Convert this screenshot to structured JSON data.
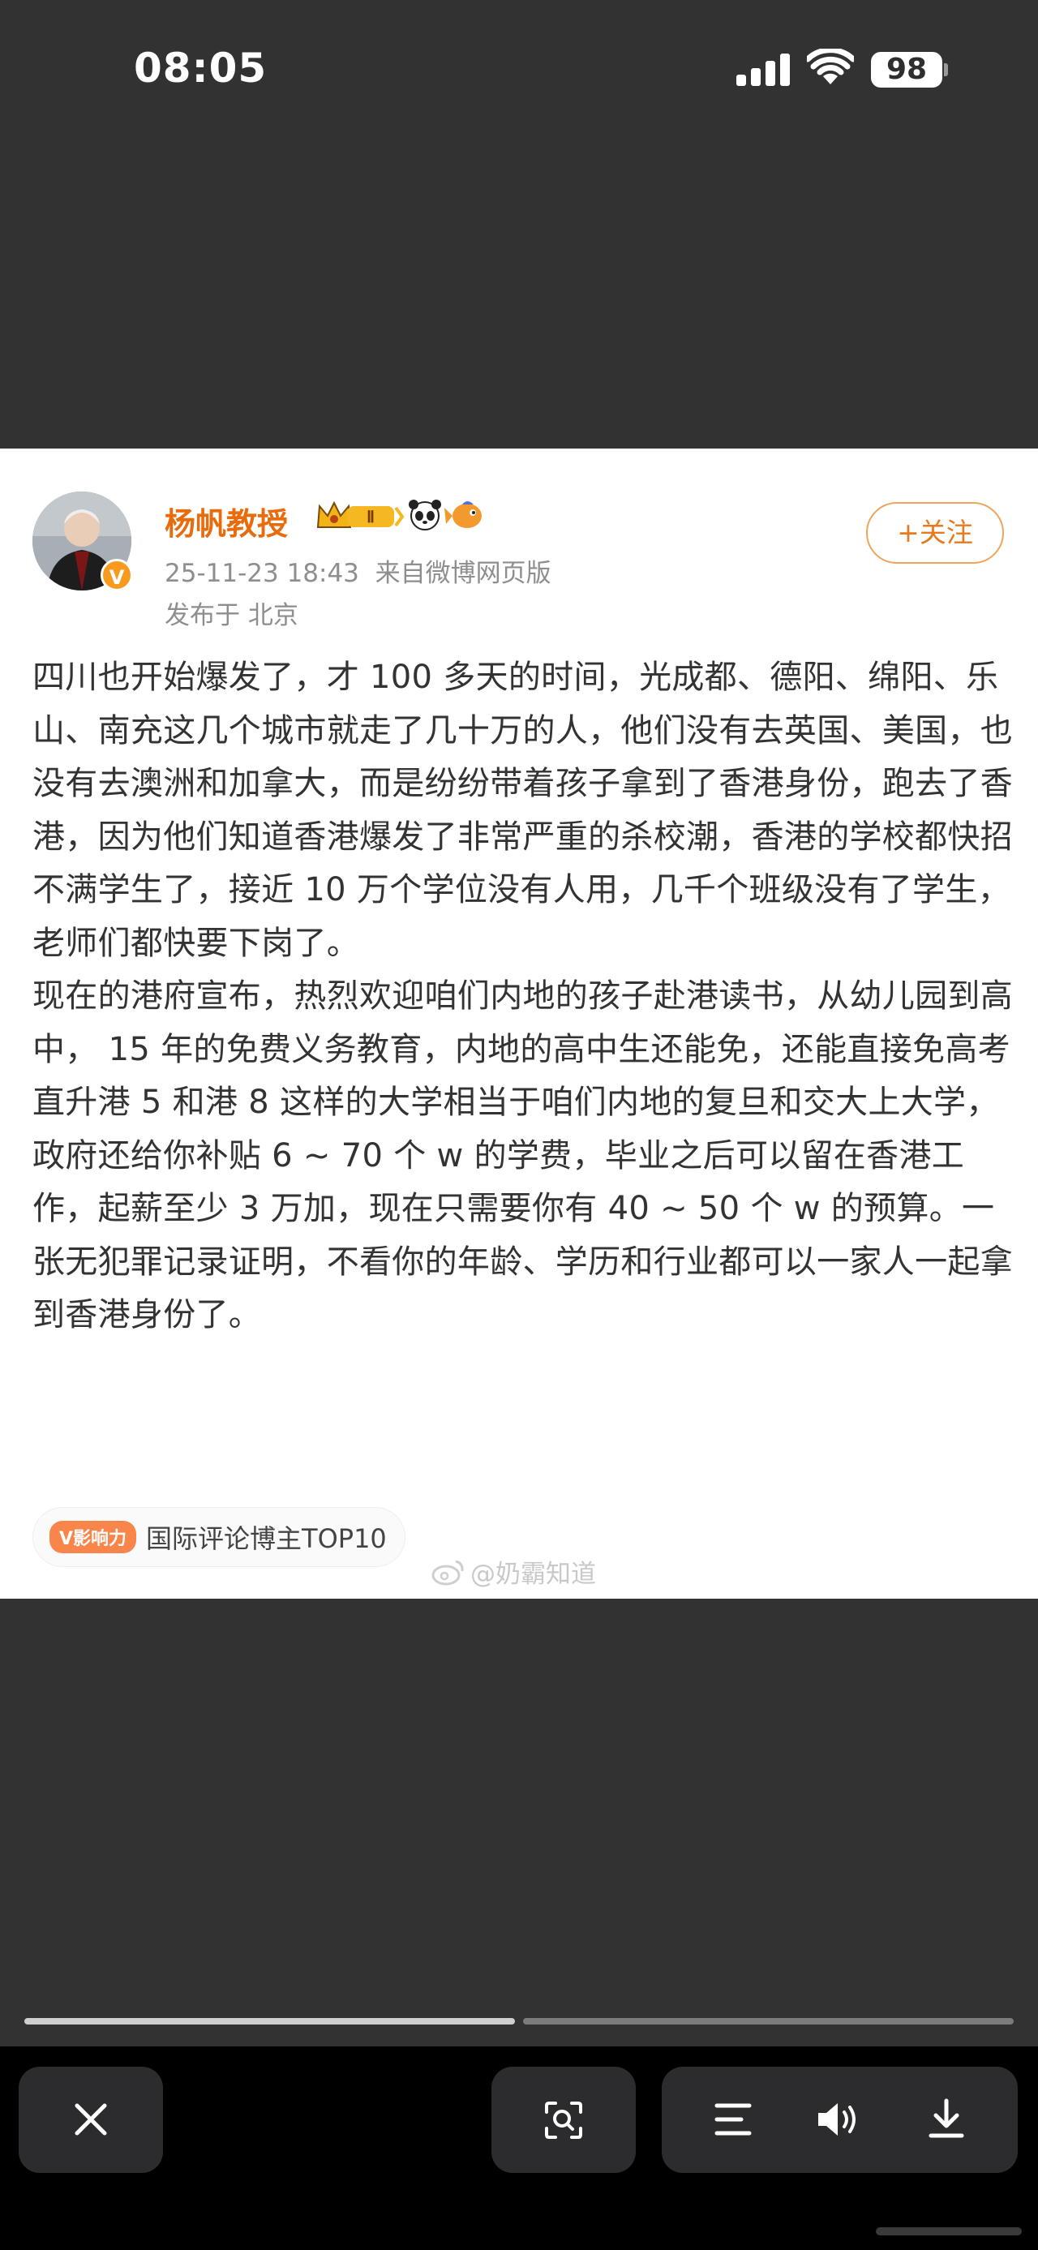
{
  "status_bar": {
    "time": "08:05",
    "battery": "98"
  },
  "post": {
    "author": "杨帆教授",
    "level_badge": "Ⅱ",
    "timestamp": "25-11-23 18:43",
    "source": "来自微博网页版",
    "location": "发布于 北京",
    "follow_label": "+关注",
    "paragraphs": [
      "四川也开始爆发了，才 100 多天的时间，光成都、德阳、绵阳、乐山、南充这几个城市就走了几十万的人，他们没有去英国、美国，也没有去澳洲和加拿大，而是纷纷带着孩子拿到了香港身份，跑去了香港，因为他们知道香港爆发了非常严重的杀校潮，香港的学校都快招不满学生了，接近 10 万个学位没有人用，几千个班级没有了学生，老师们都快要下岗了。",
      "现在的港府宣布，热烈欢迎咱们内地的孩子赴港读书，从幼儿园到高中， 15 年的免费义务教育，内地的高中生还能免，还能直接免高考直升港 5 和港 8 这样的大学相当于咱们内地的复旦和交大上大学，政府还给你补贴 6 ~ 70 个 w 的学费，毕业之后可以留在香港工作，起薪至少 3 万加，现在只需要你有 40 ~ 50 个 w 的预算。一张无犯罪记录证明，不看你的年龄、学历和行业都可以一家人一起拿到香港身份了。"
    ],
    "tag_badge": "V影响力",
    "tag_text": "国际评论博主TOP10",
    "watermark": "@奶霸知道"
  },
  "colors": {
    "accent_orange": "#e86b0c",
    "background": "#323232"
  },
  "icons": [
    "signal-icon",
    "wifi-icon",
    "battery-icon",
    "crown-icon",
    "panda-icon",
    "fish-icon",
    "weibo-icon",
    "close-icon",
    "scan-icon",
    "menu-icon",
    "speaker-icon",
    "download-icon"
  ]
}
